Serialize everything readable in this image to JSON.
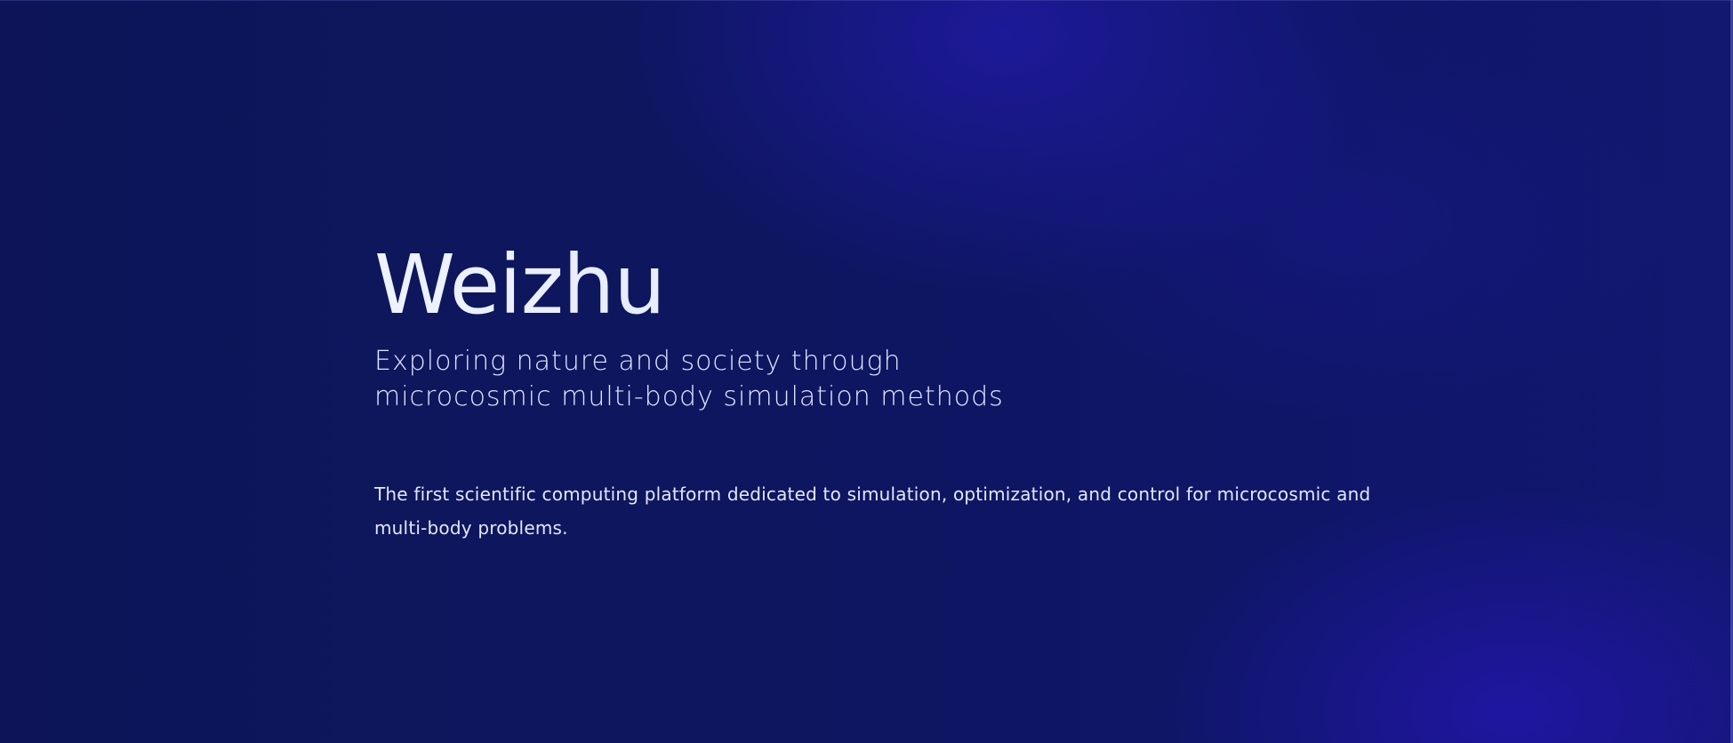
{
  "hero": {
    "title": "Weizhu",
    "tagline_line1": "Exploring nature and society through",
    "tagline_line2": "microcosmic multi-body simulation methods",
    "description": "The first scientific computing platform dedicated to simulation, optimization, and control for microcosmic and multi-body problems."
  },
  "colors": {
    "background": "#0e1660",
    "glow": "#1c18a6",
    "title_text": "#e6edff",
    "body_text": "#e3e7fb"
  }
}
